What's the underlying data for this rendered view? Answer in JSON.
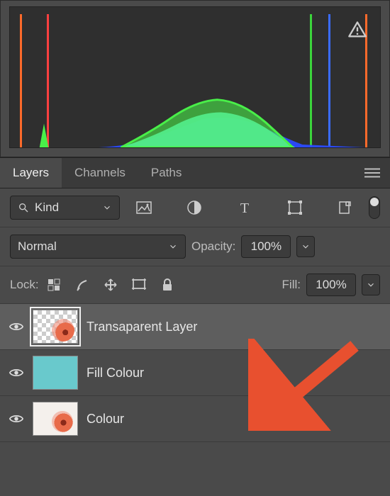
{
  "tabs": {
    "layers": "Layers",
    "channels": "Channels",
    "paths": "Paths"
  },
  "filter": {
    "kind_label": "Kind"
  },
  "blend": {
    "mode": "Normal",
    "opacity_label": "Opacity:",
    "opacity_value": "100%"
  },
  "lock": {
    "label": "Lock:",
    "fill_label": "Fill:",
    "fill_value": "100%"
  },
  "layers": [
    {
      "name": "Transaparent Layer",
      "selected": true
    },
    {
      "name": "Fill Colour",
      "selected": false
    },
    {
      "name": "Colour",
      "selected": false
    }
  ],
  "histogram": {
    "warning": true
  }
}
